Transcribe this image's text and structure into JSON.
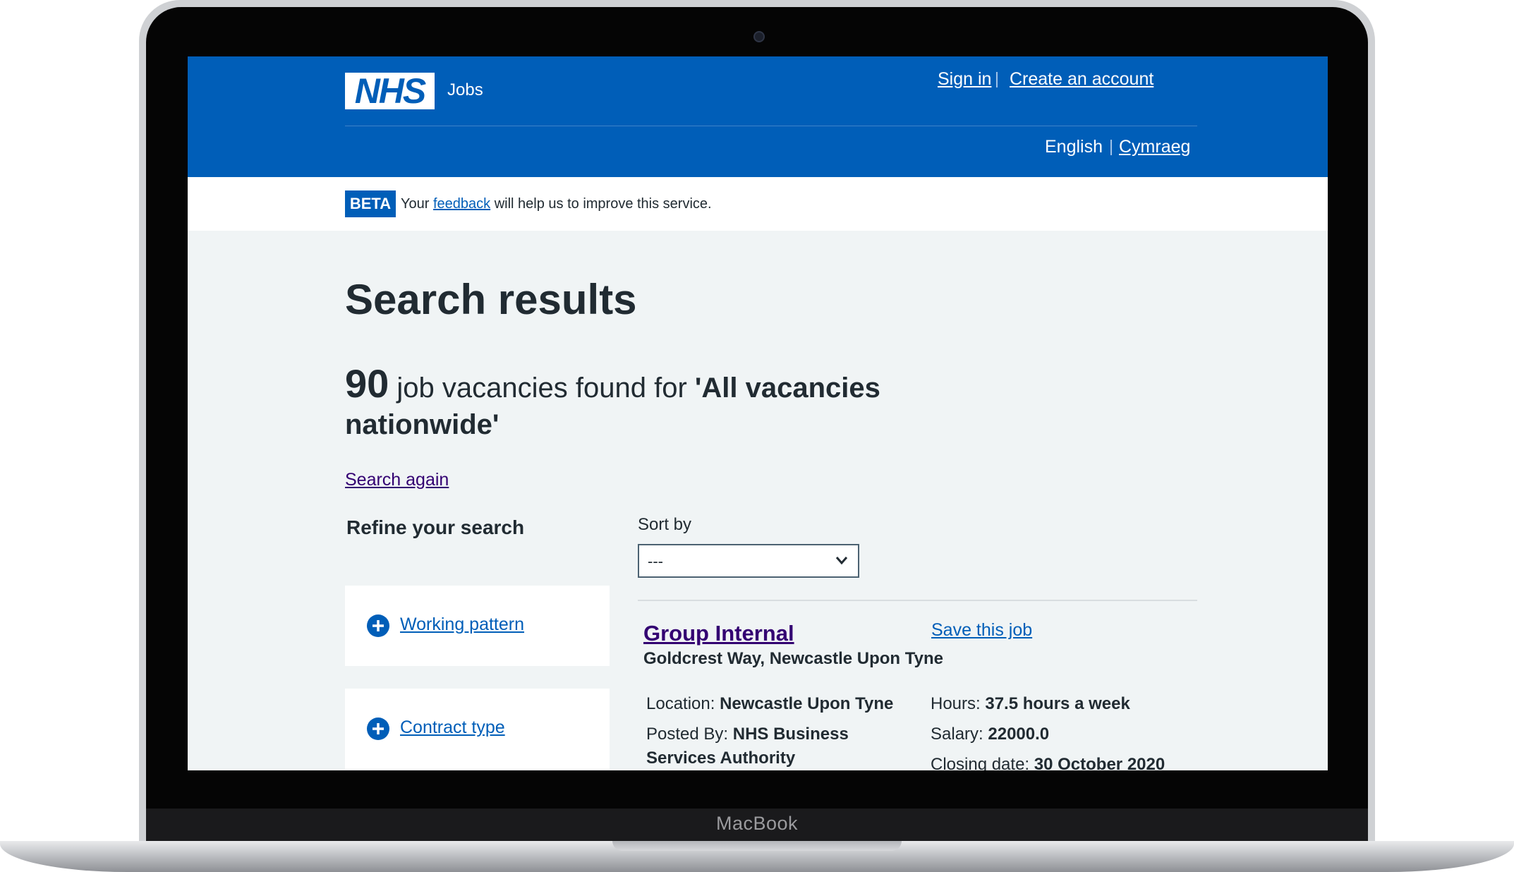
{
  "device": {
    "brand_label": "MacBook"
  },
  "header": {
    "logo_text": "NHS",
    "service_name": "Jobs",
    "sign_in": "Sign in",
    "create_account": "Create an account",
    "lang_current": "English",
    "lang_other": "Cymraeg"
  },
  "beta": {
    "tag": "BETA",
    "text_before": "Your ",
    "feedback_link": "feedback",
    "text_after": " will help us to improve this service."
  },
  "page": {
    "title": "Search results",
    "count": "90",
    "count_text": " job vacancies found for ",
    "query": "'All vacancies nationwide'",
    "search_again": "Search again"
  },
  "refine": {
    "heading": "Refine your search",
    "filters": [
      {
        "label": "Working pattern"
      },
      {
        "label": "Contract type"
      }
    ]
  },
  "sort": {
    "label": "Sort by",
    "selected": "---"
  },
  "job": {
    "title": "Group Internal",
    "save_label": "Save this job",
    "address": "Goldcrest Way, Newcastle Upon Tyne",
    "location_label": "Location: ",
    "location": "Newcastle Upon Tyne",
    "posted_label": "Posted By: ",
    "posted_line1": "NHS Business",
    "posted_line2": "Services Authority",
    "hours_label": "Hours: ",
    "hours": "37.5 hours a week",
    "salary_label": "Salary: ",
    "salary": "22000.0",
    "closing_label": "Closing date: ",
    "closing": "30 October 2020"
  },
  "colors": {
    "nhs_blue": "#005eb8",
    "background": "#f0f4f5",
    "visited_link": "#330072"
  }
}
